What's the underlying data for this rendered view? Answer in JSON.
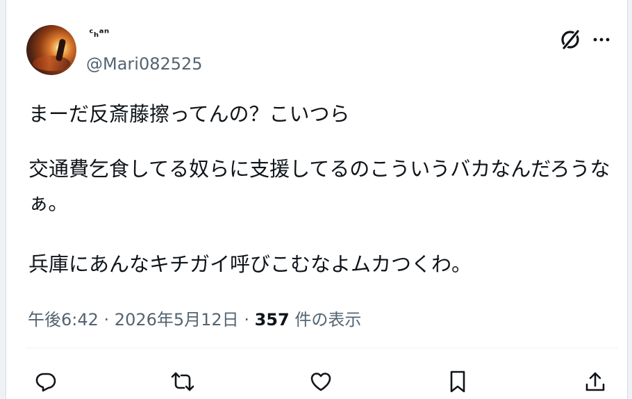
{
  "tweet": {
    "author": {
      "display_name": "ᶜₕᵃⁿ",
      "username": "@Mari082525"
    },
    "text": {
      "line1": "まーだ反斎藤擦ってんの？こいつら",
      "line2": "交通費乞食してる奴らに支援してるのこういうバカなんだろうなぁ。",
      "line3": "兵庫にあんなキチガイ呼びこむなよムカつくわ。"
    },
    "meta": {
      "time": "午後6:42",
      "separator1": " · ",
      "date": "2026年5月12日",
      "separator2": " · ",
      "views_count": "357",
      "views_label": " 件の表示"
    },
    "icons": {
      "grok": "grok-icon",
      "more": "more-icon",
      "reply": "reply-icon",
      "retweet": "retweet-icon",
      "like": "like-icon",
      "bookmark": "bookmark-icon",
      "share": "share-icon"
    },
    "colors": {
      "text": "#0f1419",
      "secondary": "#536471",
      "divider": "#eff3f4"
    }
  }
}
